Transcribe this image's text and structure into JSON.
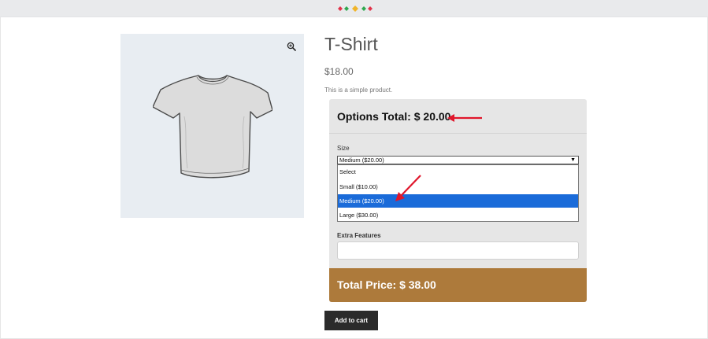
{
  "product": {
    "title": "T-Shirt",
    "price": "$18.00",
    "description": "This is a simple product."
  },
  "options": {
    "total_label": "Options Total: $ 20.00",
    "size": {
      "label": "Size",
      "selected_value": "Medium ($20.00)",
      "options": [
        {
          "label": "Select",
          "selected": false
        },
        {
          "label": "Small ($10.00)",
          "selected": false
        },
        {
          "label": "Medium ($20.00)",
          "selected": true
        },
        {
          "label": "Large ($30.00)",
          "selected": false
        }
      ]
    },
    "extra_features": {
      "label": "Extra Features",
      "value": ""
    }
  },
  "total": {
    "label": "Total Price: $ 38.00"
  },
  "cart": {
    "button_label": "Add to cart"
  },
  "colors": {
    "accent_total_bar": "#ad7a3b",
    "selected_option": "#1a6bd9",
    "annotation_arrow": "#e0162b",
    "button_dark": "#2b2b2b"
  },
  "icons": {
    "zoom": "zoom-in-icon",
    "brand_dots": "colored-dots-logo"
  }
}
